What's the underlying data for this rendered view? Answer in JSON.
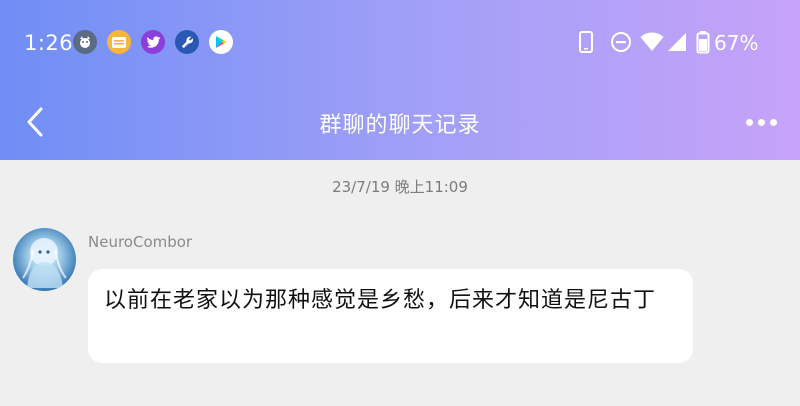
{
  "status_bar": {
    "time": "1:26",
    "battery": "67%",
    "notification_icons": [
      "dog-app-icon",
      "folder-app-icon",
      "twitter-icon",
      "wrench-icon",
      "play-store-icon"
    ],
    "system_icons": [
      "phone-icon",
      "do-not-disturb-icon",
      "wifi-icon",
      "cellular-signal-icon",
      "battery-icon"
    ]
  },
  "header": {
    "title": "群聊的聊天记录",
    "back_icon": "chevron-left-icon",
    "more_icon": "more-horizontal-icon",
    "gradient": [
      "#6f8ef5",
      "#a3a0f7",
      "#c6a3f9"
    ]
  },
  "chat": {
    "timestamp": "23/7/19 晚上11:09",
    "messages": [
      {
        "sender": "NeuroCombor",
        "text": "以前在老家以为那种感觉是乡愁，后来才知道是尼古丁"
      }
    ]
  },
  "colors": {
    "background": "#efefef",
    "bubble": "#ffffff",
    "sender_text": "#8a8a8a",
    "timestamp_text": "#7c7c7c"
  }
}
